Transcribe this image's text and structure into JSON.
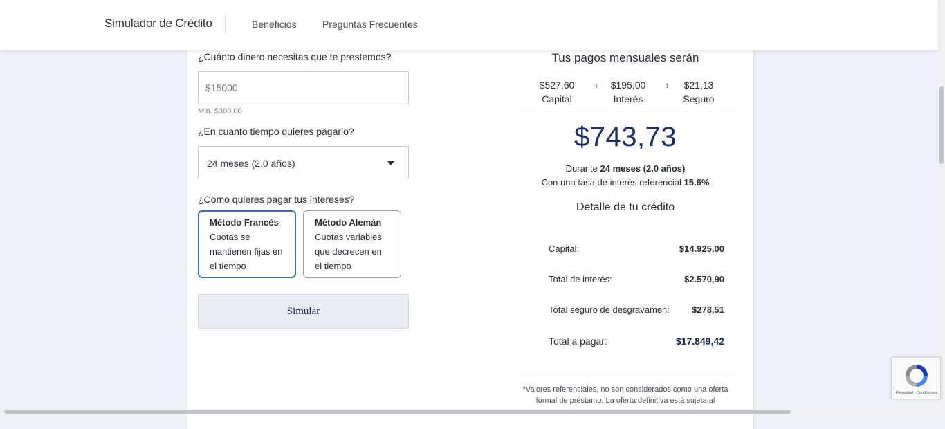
{
  "header": {
    "brand": "Simulador de Crédito",
    "nav": [
      "Beneficios",
      "Preguntas Frecuentes"
    ]
  },
  "form": {
    "amount_question": "¿Cuánto dinero necesitas que te prestemos?",
    "amount_value": "$15000",
    "amount_min": "Min. $300,00",
    "term_question": "¿En cuanto tiempo quieres pagarlo?",
    "term_value": "24 meses (2.0 años)",
    "method_question": "¿Como quieres pagar tus intereses?",
    "methods": [
      {
        "title": "Método Francés",
        "desc": "Cuotas se mantienen fijas en el tiempo",
        "selected": true
      },
      {
        "title": "Método Alemán",
        "desc": "Cuotas variables que decrecen en el tiempo",
        "selected": false
      }
    ],
    "simulate_label": "Simular"
  },
  "result": {
    "title": "Tus pagos mensuales serán",
    "breakdown": [
      {
        "amount": "$527,60",
        "label": "Capital"
      },
      {
        "amount": "$195,00",
        "label": "Interés"
      },
      {
        "amount": "$21,13",
        "label": "Seguro"
      }
    ],
    "plus": "+",
    "monthly_total": "$743,73",
    "duration_prefix": "Durante",
    "duration_value": "24 meses (2.0 años)",
    "rate_prefix": "Con una tasa de interés referencial",
    "rate_value": "15.6%",
    "detail_title": "Detalle de tu crédito",
    "details": [
      {
        "label": "Capital:",
        "value": "$14.925,00"
      },
      {
        "label": "Total de interés:",
        "value": "$2.570,90"
      },
      {
        "label": "Total seguro de desgravamen:",
        "value": "$278,51"
      },
      {
        "label": "Total a pagar:",
        "value": "$17.849,42"
      }
    ],
    "disclaimer": "*Valores referenciales, no son considerados como una oferta formal de préstamo. La oferta definitiva está sujeta al"
  },
  "recaptcha": {
    "footer": "Privacidad - Condiciones"
  },
  "colors": {
    "accent": "#3a6fb5",
    "amount": "#1e2d6b",
    "background": "#eef2f8"
  }
}
